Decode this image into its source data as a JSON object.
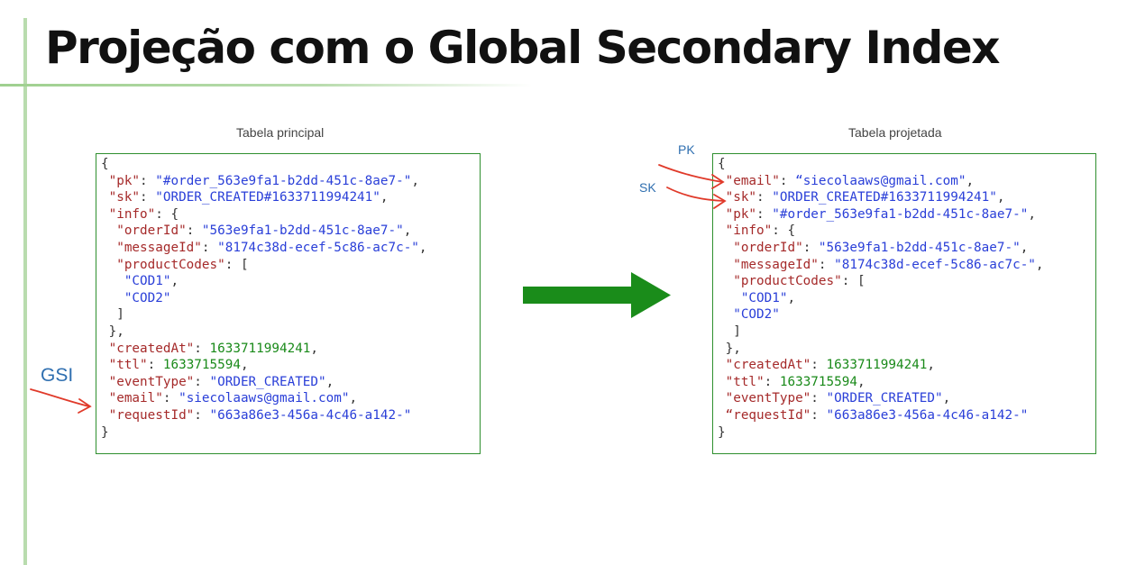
{
  "slide": {
    "title": "Projeção com o Global Secondary Index"
  },
  "left": {
    "caption": "Tabela principal",
    "lines": [
      [
        {
          "t": "{",
          "c": "p"
        }
      ],
      [
        {
          "t": " ",
          "c": "p"
        },
        {
          "t": "\"pk\"",
          "c": "k"
        },
        {
          "t": ": ",
          "c": "p"
        },
        {
          "t": "\"#order_563e9fa1-b2dd-451c-8ae7-\"",
          "c": "s"
        },
        {
          "t": ",",
          "c": "p"
        }
      ],
      [
        {
          "t": " ",
          "c": "p"
        },
        {
          "t": "\"sk\"",
          "c": "k"
        },
        {
          "t": ": ",
          "c": "p"
        },
        {
          "t": "\"ORDER_CREATED#1633711994241\"",
          "c": "s"
        },
        {
          "t": ",",
          "c": "p"
        }
      ],
      [
        {
          "t": " ",
          "c": "p"
        },
        {
          "t": "\"info\"",
          "c": "k"
        },
        {
          "t": ": {",
          "c": "p"
        }
      ],
      [
        {
          "t": "  ",
          "c": "p"
        },
        {
          "t": "\"orderId\"",
          "c": "k"
        },
        {
          "t": ": ",
          "c": "p"
        },
        {
          "t": "\"563e9fa1-b2dd-451c-8ae7-\"",
          "c": "s"
        },
        {
          "t": ",",
          "c": "p"
        }
      ],
      [
        {
          "t": "  ",
          "c": "p"
        },
        {
          "t": "\"messageId\"",
          "c": "k"
        },
        {
          "t": ": ",
          "c": "p"
        },
        {
          "t": "\"8174c38d-ecef-5c86-ac7c-\"",
          "c": "s"
        },
        {
          "t": ",",
          "c": "p"
        }
      ],
      [
        {
          "t": "  ",
          "c": "p"
        },
        {
          "t": "\"productCodes\"",
          "c": "k"
        },
        {
          "t": ": [",
          "c": "p"
        }
      ],
      [
        {
          "t": "   ",
          "c": "p"
        },
        {
          "t": "\"COD1\"",
          "c": "s"
        },
        {
          "t": ",",
          "c": "p"
        }
      ],
      [
        {
          "t": "   ",
          "c": "p"
        },
        {
          "t": "\"COD2\"",
          "c": "s"
        }
      ],
      [
        {
          "t": "  ]",
          "c": "p"
        }
      ],
      [
        {
          "t": " },",
          "c": "p"
        }
      ],
      [
        {
          "t": " ",
          "c": "p"
        },
        {
          "t": "\"createdAt\"",
          "c": "k"
        },
        {
          "t": ": ",
          "c": "p"
        },
        {
          "t": "1633711994241",
          "c": "n"
        },
        {
          "t": ",",
          "c": "p"
        }
      ],
      [
        {
          "t": " ",
          "c": "p"
        },
        {
          "t": "\"ttl\"",
          "c": "k"
        },
        {
          "t": ": ",
          "c": "p"
        },
        {
          "t": "1633715594",
          "c": "n"
        },
        {
          "t": ",",
          "c": "p"
        }
      ],
      [
        {
          "t": " ",
          "c": "p"
        },
        {
          "t": "\"eventType\"",
          "c": "k"
        },
        {
          "t": ": ",
          "c": "p"
        },
        {
          "t": "\"ORDER_CREATED\"",
          "c": "s"
        },
        {
          "t": ",",
          "c": "p"
        }
      ],
      [
        {
          "t": " ",
          "c": "p"
        },
        {
          "t": "\"email\"",
          "c": "k"
        },
        {
          "t": ": ",
          "c": "p"
        },
        {
          "t": "\"siecolaaws@gmail.com\"",
          "c": "s"
        },
        {
          "t": ",",
          "c": "p"
        }
      ],
      [
        {
          "t": " ",
          "c": "p"
        },
        {
          "t": "\"requestId\"",
          "c": "k"
        },
        {
          "t": ": ",
          "c": "p"
        },
        {
          "t": "\"663a86e3-456a-4c46-a142-\"",
          "c": "s"
        }
      ],
      [
        {
          "t": "}",
          "c": "p"
        }
      ]
    ]
  },
  "right": {
    "caption": "Tabela projetada",
    "lines": [
      [
        {
          "t": "{",
          "c": "p"
        }
      ],
      [
        {
          "t": " ",
          "c": "p"
        },
        {
          "t": "\"email\"",
          "c": "k"
        },
        {
          "t": ": ",
          "c": "p"
        },
        {
          "t": "“siecolaaws@gmail.com\"",
          "c": "s"
        },
        {
          "t": ",",
          "c": "p"
        }
      ],
      [
        {
          "t": " ",
          "c": "p"
        },
        {
          "t": "\"sk\"",
          "c": "k"
        },
        {
          "t": ": ",
          "c": "p"
        },
        {
          "t": "\"ORDER_CREATED#1633711994241\"",
          "c": "s"
        },
        {
          "t": ",",
          "c": "p"
        }
      ],
      [
        {
          "t": " ",
          "c": "p"
        },
        {
          "t": "\"pk\"",
          "c": "k"
        },
        {
          "t": ": ",
          "c": "p"
        },
        {
          "t": "\"#order_563e9fa1-b2dd-451c-8ae7-\"",
          "c": "s"
        },
        {
          "t": ",",
          "c": "p"
        }
      ],
      [
        {
          "t": " ",
          "c": "p"
        },
        {
          "t": "\"info\"",
          "c": "k"
        },
        {
          "t": ": {",
          "c": "p"
        }
      ],
      [
        {
          "t": "  ",
          "c": "p"
        },
        {
          "t": "\"orderId\"",
          "c": "k"
        },
        {
          "t": ": ",
          "c": "p"
        },
        {
          "t": "\"563e9fa1-b2dd-451c-8ae7-\"",
          "c": "s"
        },
        {
          "t": ",",
          "c": "p"
        }
      ],
      [
        {
          "t": "  ",
          "c": "p"
        },
        {
          "t": "\"messageId\"",
          "c": "k"
        },
        {
          "t": ": ",
          "c": "p"
        },
        {
          "t": "\"8174c38d-ecef-5c86-ac7c-\"",
          "c": "s"
        },
        {
          "t": ",",
          "c": "p"
        }
      ],
      [
        {
          "t": "  ",
          "c": "p"
        },
        {
          "t": "\"productCodes\"",
          "c": "k"
        },
        {
          "t": ": [",
          "c": "p"
        }
      ],
      [
        {
          "t": "   ",
          "c": "p"
        },
        {
          "t": "\"COD1\"",
          "c": "s"
        },
        {
          "t": ",",
          "c": "p"
        }
      ],
      [
        {
          "t": "  ",
          "c": "p"
        },
        {
          "t": "\"COD2\"",
          "c": "s"
        }
      ],
      [
        {
          "t": "  ]",
          "c": "p"
        }
      ],
      [
        {
          "t": " },",
          "c": "p"
        }
      ],
      [
        {
          "t": " ",
          "c": "p"
        },
        {
          "t": "\"createdAt\"",
          "c": "k"
        },
        {
          "t": ": ",
          "c": "p"
        },
        {
          "t": "1633711994241",
          "c": "n"
        },
        {
          "t": ",",
          "c": "p"
        }
      ],
      [
        {
          "t": " ",
          "c": "p"
        },
        {
          "t": "\"ttl\"",
          "c": "k"
        },
        {
          "t": ": ",
          "c": "p"
        },
        {
          "t": "1633715594",
          "c": "n"
        },
        {
          "t": ",",
          "c": "p"
        }
      ],
      [
        {
          "t": " ",
          "c": "p"
        },
        {
          "t": "\"eventType\"",
          "c": "k"
        },
        {
          "t": ": ",
          "c": "p"
        },
        {
          "t": "\"ORDER_CREATED\"",
          "c": "s"
        },
        {
          "t": ",",
          "c": "p"
        }
      ],
      [
        {
          "t": " ",
          "c": "p"
        },
        {
          "t": "“requestId\"",
          "c": "k"
        },
        {
          "t": ": ",
          "c": "p"
        },
        {
          "t": "\"663a86e3-456a-4c46-a142-\"",
          "c": "s"
        }
      ],
      [
        {
          "t": "}",
          "c": "p"
        }
      ]
    ]
  },
  "annotations": {
    "gsi": "GSI",
    "pk": "PK",
    "sk": "SK"
  },
  "colors": {
    "title": "#111111",
    "box_border": "#2f8f2f",
    "json_key": "#a52a2a",
    "json_string": "#2a3fd8",
    "json_number": "#1a8a1a",
    "annotation_label": "#2f6fb0",
    "annotation_arrow": "#e03a2a",
    "transform_arrow": "#1a8c1a"
  },
  "icons": {
    "transform": "green-right-arrow-icon",
    "pointer": "red-curved-arrow-icon"
  }
}
